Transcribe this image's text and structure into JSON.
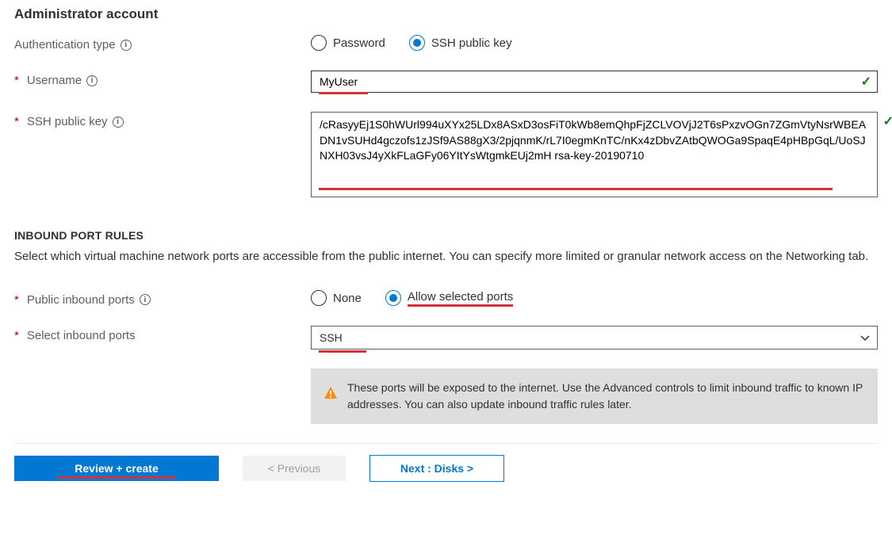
{
  "adminAccount": {
    "title": "Administrator account",
    "authTypeLabel": "Authentication type",
    "authOptions": {
      "password": "Password",
      "ssh": "SSH public key"
    },
    "usernameLabel": "Username",
    "usernameValue": "MyUser",
    "sshKeyLabel": "SSH public key",
    "sshKeyValue": "/cRasyyEj1S0hWUrl994uXYx25LDx8ASxD3osFiT0kWb8emQhpFjZCLVOVjJ2T6sPxzvOGn7ZGmVtyNsrWBEADN1vSUHd4gczofs1zJSf9AS88gX3/2pjqnmK/rL7I0egmKnTC/nKx4zDbvZAtbQWOGa9SpaqE4pHBpGqL/UoSJNXH03vsJ4yXkFLaGFy06YItYsWtgmkEUj2mH rsa-key-20190710"
  },
  "inboundPorts": {
    "heading": "INBOUND PORT RULES",
    "description": "Select which virtual machine network ports are accessible from the public internet. You can specify more limited or granular network access on the Networking tab.",
    "publicPortsLabel": "Public inbound ports",
    "publicOptions": {
      "none": "None",
      "allow": "Allow selected ports"
    },
    "selectPortsLabel": "Select inbound ports",
    "selectPortsValue": "SSH",
    "bannerText": "These ports will be exposed to the internet. Use the Advanced controls to limit inbound traffic to known IP addresses. You can also update inbound traffic rules later."
  },
  "footer": {
    "reviewCreate": "Review + create",
    "previous": "< Previous",
    "next": "Next : Disks >"
  }
}
